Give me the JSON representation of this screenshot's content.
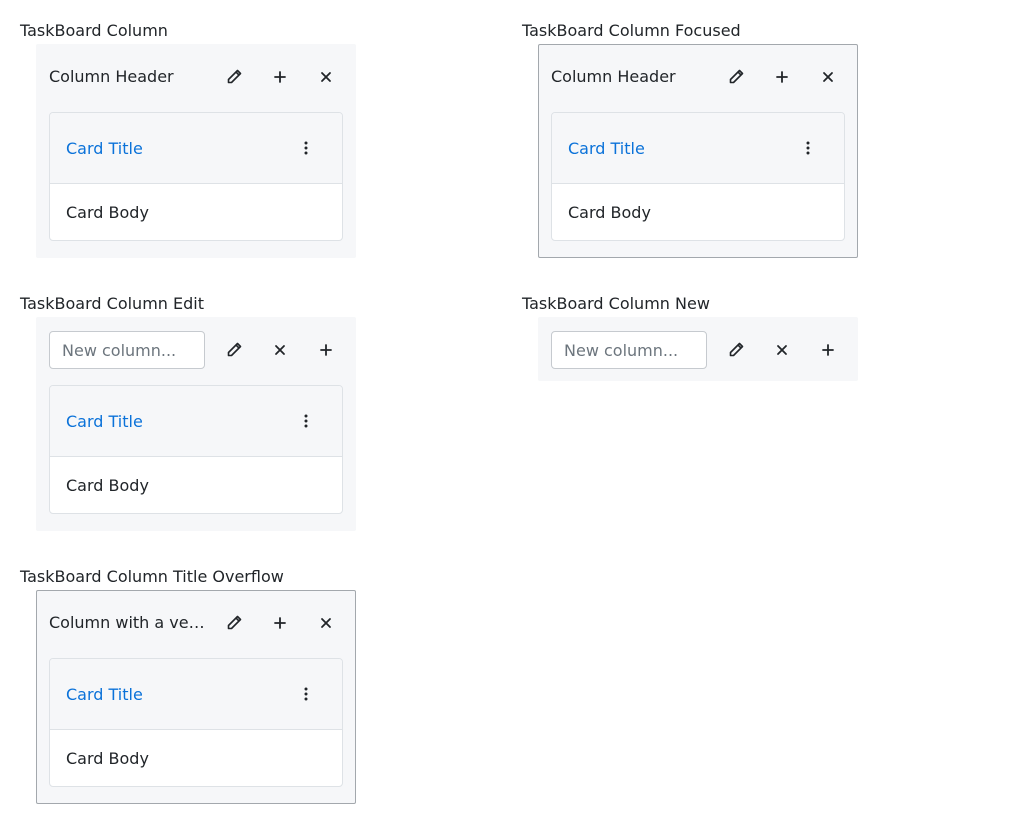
{
  "demos": {
    "default": {
      "label": "TaskBoard Column",
      "column_title": "Column Header",
      "card": {
        "title": "Card Title",
        "body": "Card Body"
      }
    },
    "focused": {
      "label": "TaskBoard Column Focused",
      "column_title": "Column Header",
      "card": {
        "title": "Card Title",
        "body": "Card Body"
      }
    },
    "edit": {
      "label": "TaskBoard Column Edit",
      "input_placeholder": "New column...",
      "card": {
        "title": "Card Title",
        "body": "Card Body"
      }
    },
    "new": {
      "label": "TaskBoard Column New",
      "input_placeholder": "New column..."
    },
    "overflow": {
      "label": "TaskBoard Column Title Overflow",
      "column_title": "Column with a very long title that overflows",
      "card": {
        "title": "Card Title",
        "body": "Card Body"
      }
    }
  },
  "icons": {
    "edit": "pencil-icon",
    "add": "plus-icon",
    "close": "close-icon",
    "menu": "kebab-menu-icon"
  },
  "colors": {
    "link": "#0b72d9",
    "column_bg": "#f6f7f9",
    "focus_border": "#a3a8ad"
  }
}
